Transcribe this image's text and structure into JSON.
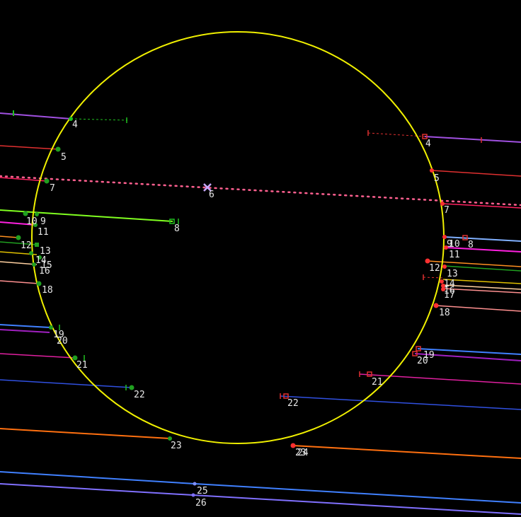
{
  "circle": {
    "color": "#f0f000"
  },
  "center_marker": {
    "label": "6",
    "icon": "x-marker-icon",
    "color": "#c8a8ff"
  },
  "left_track_labels": [
    "4",
    "5",
    "7",
    "10",
    "9",
    "11",
    "12",
    "13",
    "14",
    "15",
    "16",
    "18",
    "19",
    "20",
    "21",
    "22",
    "23"
  ],
  "right_track_labels": [
    "4",
    "5",
    "7",
    "9",
    "10",
    "8",
    "11",
    "12",
    "13",
    "14",
    "16",
    "17",
    "18",
    "19",
    "20",
    "21",
    "22",
    "23",
    "24"
  ],
  "center_labels": [
    "8",
    "25",
    "26"
  ],
  "colors": {
    "purple": "#a050e0",
    "red": "#e03030",
    "pink_dots": "#ff6090",
    "green": "#20c020",
    "lime": "#80ff20",
    "magenta": "#ff20e0",
    "orange": "#ff9020",
    "blue": "#4080ff",
    "violet": "#8070ff",
    "salmon": "#ff9090",
    "teal": "#40c0a0"
  }
}
